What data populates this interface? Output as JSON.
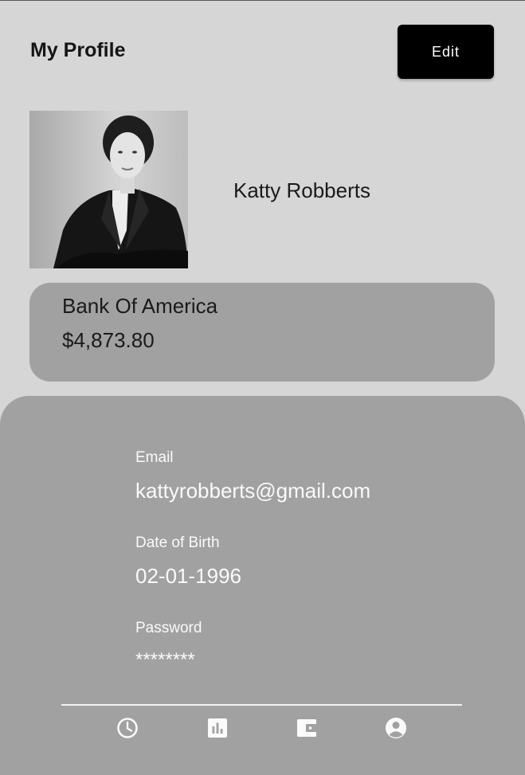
{
  "header": {
    "title": "My Profile",
    "edit_label": "Edit"
  },
  "profile": {
    "name": "Katty Robberts"
  },
  "bank": {
    "name": "Bank Of America",
    "balance": "$4,873.80"
  },
  "details": {
    "email_label": "Email",
    "email_value": "kattyrobberts@gmail.com",
    "dob_label": "Date of Birth",
    "dob_value": "02-01-1996",
    "password_label": "Password",
    "password_value": "********"
  },
  "nav": {
    "items": [
      "clock-icon",
      "chart-icon",
      "wallet-icon",
      "account-icon"
    ]
  },
  "colors": {
    "background": "#d6d6d6",
    "card": "#a1a1a1",
    "button": "#000000",
    "panel_text": "#fafafa"
  }
}
